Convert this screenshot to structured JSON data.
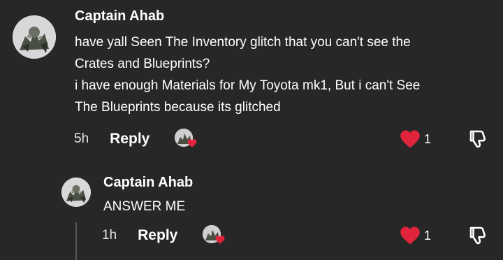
{
  "comments": [
    {
      "username": "Captain Ahab",
      "text_lines": [
        "have yall Seen The Inventory glitch that you can't see the",
        "Crates and Blueprints?",
        "i have enough Materials for My Toyota mk1, But i can't See",
        "The Blueprints because its glitched"
      ],
      "time": "5h",
      "reply_label": "Reply",
      "like_count": "1",
      "icons": {
        "avatar": "avatar",
        "liker": "liker-avatar",
        "like": "heart-icon",
        "dislike": "thumbs-down-icon"
      }
    },
    {
      "username": "Captain Ahab",
      "text_lines": [
        "ANSWER ME"
      ],
      "time": "1h",
      "reply_label": "Reply",
      "like_count": "1",
      "icons": {
        "avatar": "avatar",
        "liker": "liker-avatar",
        "like": "heart-icon",
        "dislike": "thumbs-down-icon"
      }
    }
  ],
  "colors": {
    "background": "#272727",
    "text": "#ffffff",
    "heart": "#e0243c",
    "thread_line": "#5a5a5a"
  }
}
